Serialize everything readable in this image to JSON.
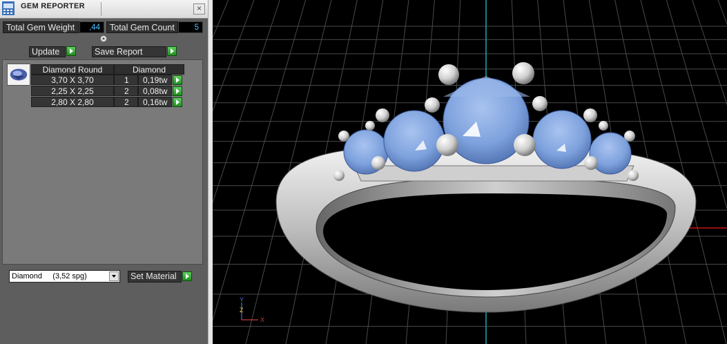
{
  "window": {
    "title": "GEM REPORTER",
    "close_glyph": "×"
  },
  "summary": {
    "weight_label": "Total Gem Weight",
    "weight_value": ",44",
    "count_label": "Total Gem Count",
    "count_value": "5"
  },
  "actions": {
    "update_label": "Update",
    "save_report_label": "Save Report"
  },
  "gem_table": {
    "headers": [
      "Diamond Round",
      "Diamond"
    ],
    "rows": [
      {
        "size": "3,70 X 3,70",
        "qty": "1",
        "weight": "0,19tw"
      },
      {
        "size": "2,25 X 2,25",
        "qty": "2",
        "weight": "0,08tw"
      },
      {
        "size": "2,80 X 2,80",
        "qty": "2",
        "weight": "0,16tw"
      }
    ]
  },
  "material": {
    "selected": "Diamond     (3,52 spg)",
    "set_label": "Set Material"
  },
  "viewport": {
    "axes_labels": {
      "z": "Z",
      "y": "Y",
      "x": "X"
    },
    "colors": {
      "grid": "#4a4a4a",
      "axis_v": "#1aa9b3",
      "axis_h": "#c81414",
      "gem": "#7fa4de",
      "metal": "#d8d8d8"
    }
  },
  "icons": [
    "app-icon",
    "close-icon",
    "collapse-arrow-icon",
    "green-arrow-icon",
    "gem-thumbnail-icon",
    "dropdown-arrow-icon",
    "axis-triad-icon"
  ]
}
